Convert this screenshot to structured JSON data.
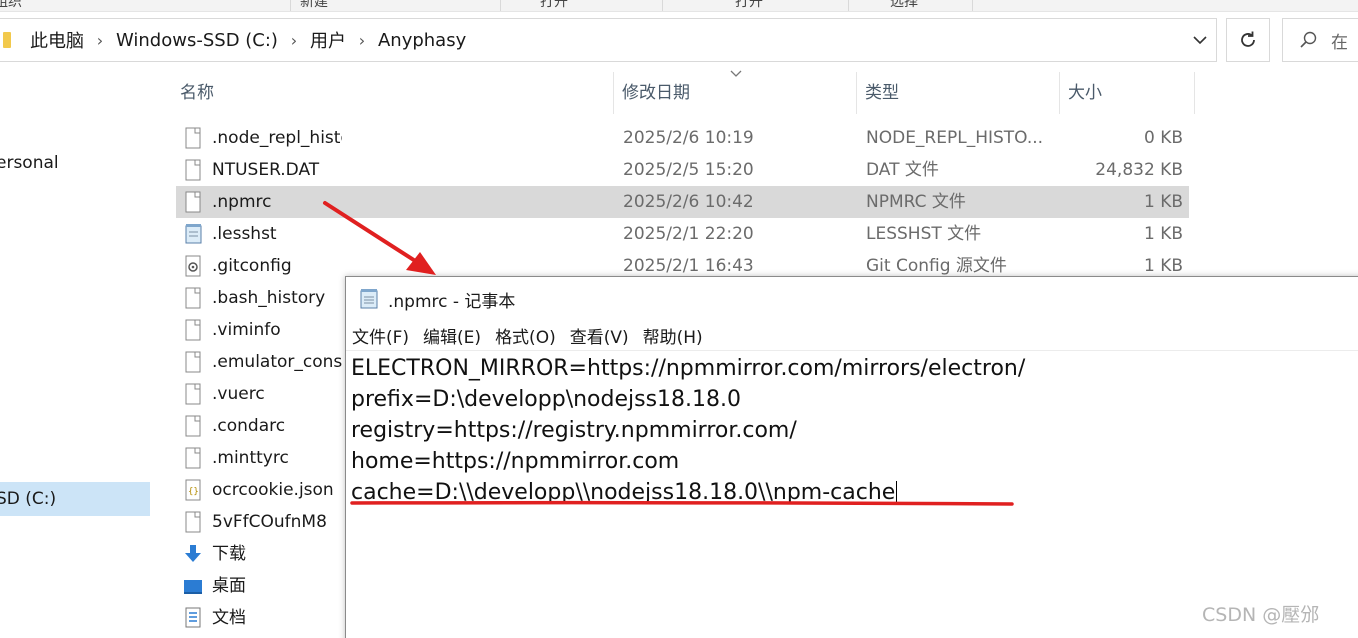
{
  "ribbon": {
    "labels": [
      "组织",
      "新建",
      "打开",
      "选择"
    ]
  },
  "address": {
    "crumbs": [
      "此电脑",
      "Windows-SSD (C:)",
      "用户",
      "Anyphasy"
    ],
    "search_placeholder": "在"
  },
  "nav": {
    "items": [
      {
        "label": "ersonal",
        "selected": false
      },
      {
        "label": "SD (C:)",
        "selected": true
      },
      {
        "label": "下载",
        "icon": "download-arrow-icon"
      },
      {
        "label": "桌面",
        "icon": "desktop-icon"
      },
      {
        "label": "文档",
        "icon": "document-icon"
      }
    ]
  },
  "columns": {
    "name": "名称",
    "date": "修改日期",
    "type": "类型",
    "size": "大小"
  },
  "files": [
    {
      "name": ".node_repl_history",
      "date": "2025/2/6 10:19",
      "type": "NODE_REPL_HISTO...",
      "size": "0 KB",
      "icon": "blank-file-icon"
    },
    {
      "name": "NTUSER.DAT",
      "date": "2025/2/5 15:20",
      "type": "DAT 文件",
      "size": "24,832 KB",
      "icon": "blank-file-icon"
    },
    {
      "name": ".npmrc",
      "date": "2025/2/6 10:42",
      "type": "NPMRC 文件",
      "size": "1 KB",
      "icon": "blank-file-icon",
      "selected": true
    },
    {
      "name": ".lesshst",
      "date": "2025/2/1 22:20",
      "type": "LESSHST 文件",
      "size": "1 KB",
      "icon": "notepad-file-icon"
    },
    {
      "name": ".gitconfig",
      "date": "2025/2/1 16:43",
      "type": "Git Config 源文件",
      "size": "1 KB",
      "icon": "config-file-icon"
    },
    {
      "name": ".bash_history",
      "icon": "blank-file-icon"
    },
    {
      "name": ".viminfo",
      "icon": "blank-file-icon"
    },
    {
      "name": ".emulator_console",
      "icon": "blank-file-icon"
    },
    {
      "name": ".vuerc",
      "icon": "blank-file-icon"
    },
    {
      "name": ".condarc",
      "icon": "blank-file-icon"
    },
    {
      "name": ".minttyrc",
      "icon": "blank-file-icon"
    },
    {
      "name": "ocrcookie.json",
      "icon": "json-file-icon"
    },
    {
      "name": "5vFfCOufnM8",
      "icon": "blank-file-icon"
    }
  ],
  "notepad": {
    "title": ".npmrc - 记事本",
    "menu": [
      "文件(F)",
      "编辑(E)",
      "格式(O)",
      "查看(V)",
      "帮助(H)"
    ],
    "lines": [
      "ELECTRON_MIRROR=https://npmmirror.com/mirrors/electron/",
      "prefix=D:\\developp\\nodejss18.18.0",
      "registry=https://registry.npmmirror.com/",
      "home=https://npmmirror.com",
      "cache=D:\\\\developp\\\\nodejss18.18.0\\\\npm-cache"
    ]
  },
  "annotation_color": "#e02020",
  "watermark": "CSDN @壓邠"
}
